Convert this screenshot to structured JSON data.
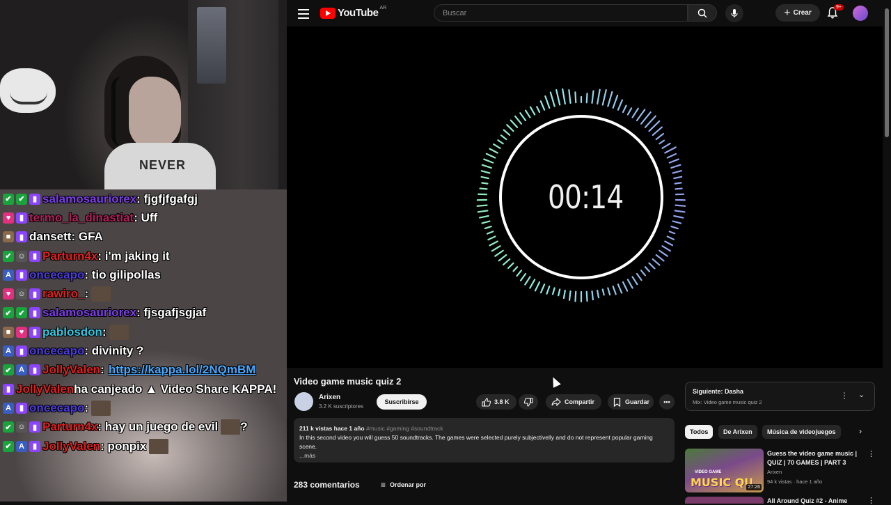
{
  "overlay": {
    "shirt_text": "NEVER",
    "chat": [
      {
        "badges": [
          "green",
          "green"
        ],
        "sub": true,
        "user": "salamosauriorex",
        "user_color": "#7b3fe4",
        "text": ": fjgfjfgafgj"
      },
      {
        "badges": [
          "pink"
        ],
        "sub": true,
        "user": "termo_la_dinastiat",
        "user_color": "#b01f5a",
        "text": ": Uff"
      },
      {
        "badges": [
          "brown"
        ],
        "sub": true,
        "user": "dansett",
        "user_color": "#ffffff",
        "text": ": GFA"
      },
      {
        "badges": [
          "green",
          "gray"
        ],
        "sub": true,
        "user": "Parturn4x",
        "user_color": "#e02020",
        "text": ": i'm jaking it"
      },
      {
        "badges": [
          "blue"
        ],
        "sub": true,
        "user": "oncecapo",
        "user_color": "#4a3ad8",
        "text": ": tio gilipollas"
      },
      {
        "badges": [
          "pink",
          "gray"
        ],
        "sub": true,
        "user": "rawiro_",
        "user_color": "#e02020",
        "text": ":",
        "emote": true
      },
      {
        "badges": [
          "green",
          "green"
        ],
        "sub": true,
        "user": "salamosauriorex",
        "user_color": "#7b3fe4",
        "text": ": fjsgafjsgjaf"
      },
      {
        "badges": [
          "brown",
          "pink"
        ],
        "sub": true,
        "user": "pablosdon",
        "user_color": "#38c6e0",
        "text": ":",
        "emote": true
      },
      {
        "badges": [
          "blue"
        ],
        "sub": true,
        "user": "oncecapo",
        "user_color": "#4a3ad8",
        "text": ": divinity ?"
      },
      {
        "badges": [
          "green",
          "blue"
        ],
        "sub": true,
        "user": "JollyValen",
        "user_color": "#e02020",
        "text": ":",
        "link": "https://kappa.lol/2NQmBM"
      },
      {
        "badges": [],
        "sub": true,
        "user": "JollyValen",
        "user_color": "#e02020",
        "text": " ha canjeado ▲ Video Share KAPPA!"
      },
      {
        "badges": [
          "blue"
        ],
        "sub": true,
        "user": "oncecapo",
        "user_color": "#4a3ad8",
        "text": ":",
        "emote": true
      },
      {
        "badges": [
          "green",
          "gray"
        ],
        "sub": true,
        "user": "Parturn4x",
        "user_color": "#e02020",
        "text": ": hay un juego de evil",
        "emote": true,
        "after": " ?"
      },
      {
        "badges": [
          "green",
          "blue"
        ],
        "sub": true,
        "user": "JollyValen",
        "user_color": "#e02020",
        "text": ": ponpix",
        "emote": true
      }
    ]
  },
  "youtube": {
    "logo_text": "YouTube",
    "country": "AR",
    "search_placeholder": "Buscar",
    "create_label": "Crear",
    "notif_count": "9+",
    "player": {
      "timer": "00:14",
      "progress": 0.03
    },
    "video": {
      "title": "Video game music quiz 2",
      "channel": "Arixen",
      "subscribers": "3.2 K suscriptores",
      "subscribe_label": "Suscribirse",
      "likes": "3.8 K",
      "share_label": "Compartir",
      "save_label": "Guardar",
      "views_date": "211 k vistas  hace 1 año",
      "hashtags": "#music #gaming #soundtrack",
      "description": "In this second video you will guess 50 soundtracks. The games were selected purely subjectivelly and do not represent popular gaming scene.",
      "more_label": "...más",
      "comments_count": "283 comentarios",
      "sort_label": "Ordenar por"
    },
    "next": {
      "label": "Siguiente: Dasha",
      "sub": "Mix: Video game music quiz 2"
    },
    "chips": [
      "Todos",
      "De Arixen",
      "Música de videojuegos"
    ],
    "recommendation": {
      "title": "Guess the video game music | QUIZ | 70 GAMES | PART 3",
      "channel": "Arixen",
      "stats": "94 k vistas · hace 1 año",
      "duration": "27:26",
      "thumb_small": "VIDEO GAME",
      "thumb_big": "MUSIC QU"
    },
    "recommendation2": {
      "title": "All Around Quiz #2 - Anime"
    }
  }
}
